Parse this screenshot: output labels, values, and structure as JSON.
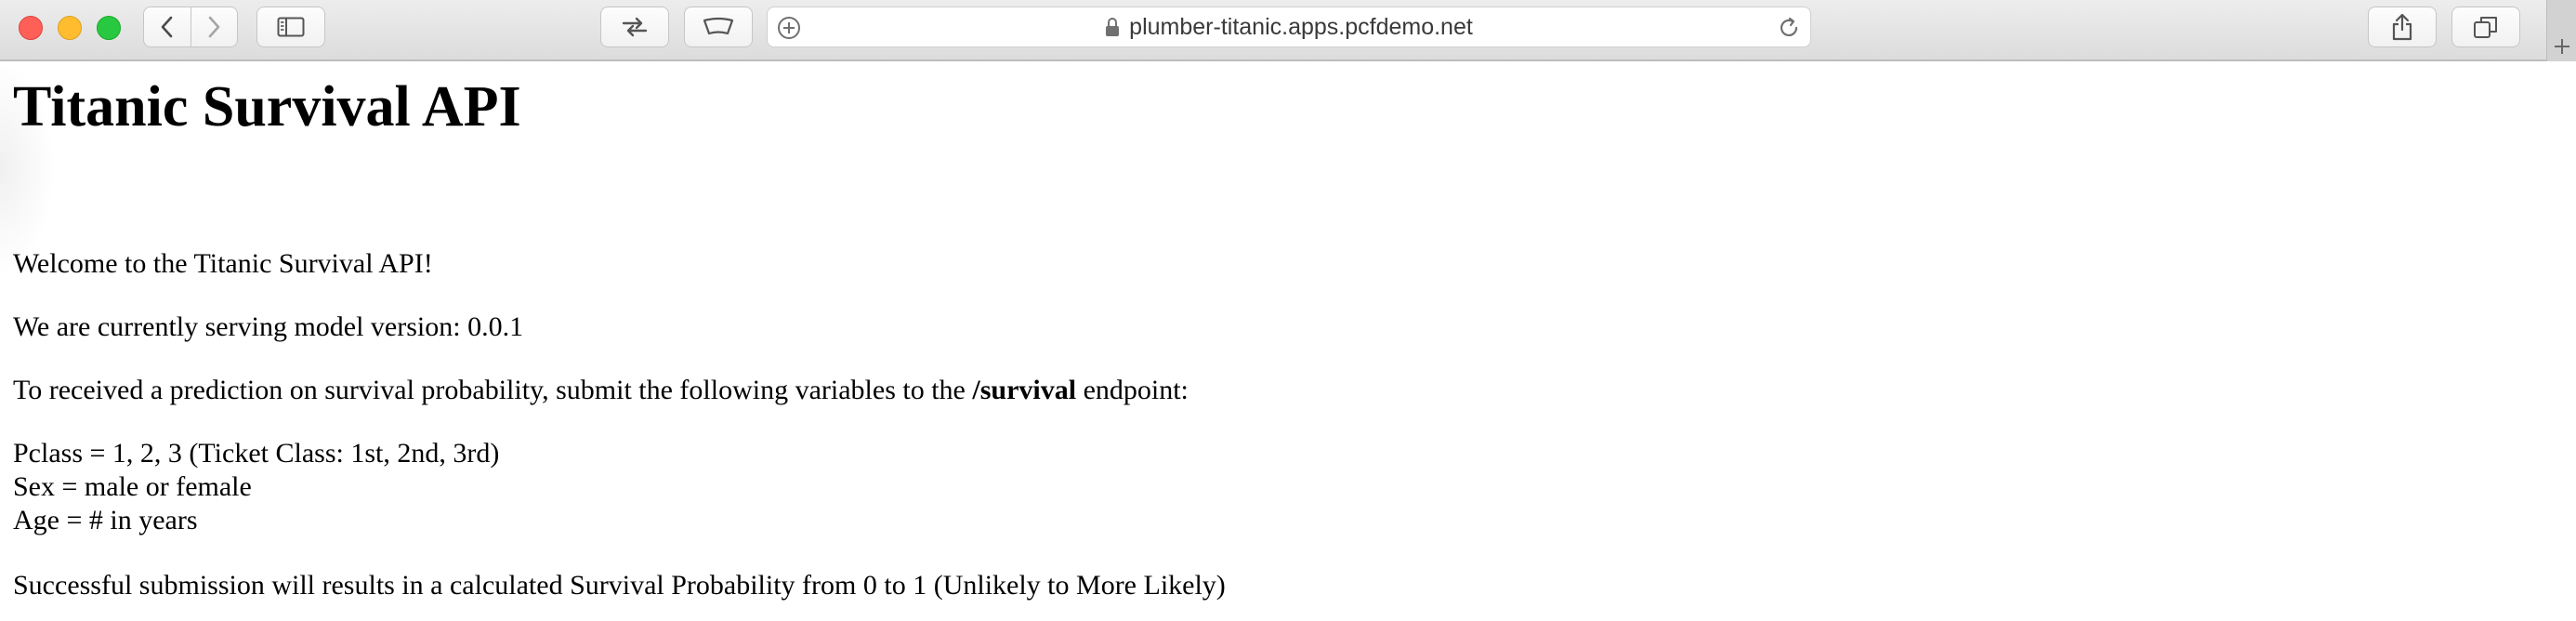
{
  "browser": {
    "url": "plumber-titanic.apps.pcfdemo.net"
  },
  "page": {
    "title": "Titanic Survival API",
    "welcome": "Welcome to the Titanic Survival API!",
    "version_line": "We are currently serving model version: 0.0.1",
    "instructions": {
      "before": "To received a prediction on survival probability, submit the following variables to the ",
      "endpoint": "/survival",
      "after": " endpoint:"
    },
    "variables": [
      "Pclass = 1, 2, 3 (Ticket Class: 1st, 2nd, 3rd)",
      "Sex = male or female",
      "Age = # in years"
    ],
    "result_line": "Successful submission will results in a calculated Survival Probability from 0 to 1 (Unlikely to More Likely)"
  }
}
